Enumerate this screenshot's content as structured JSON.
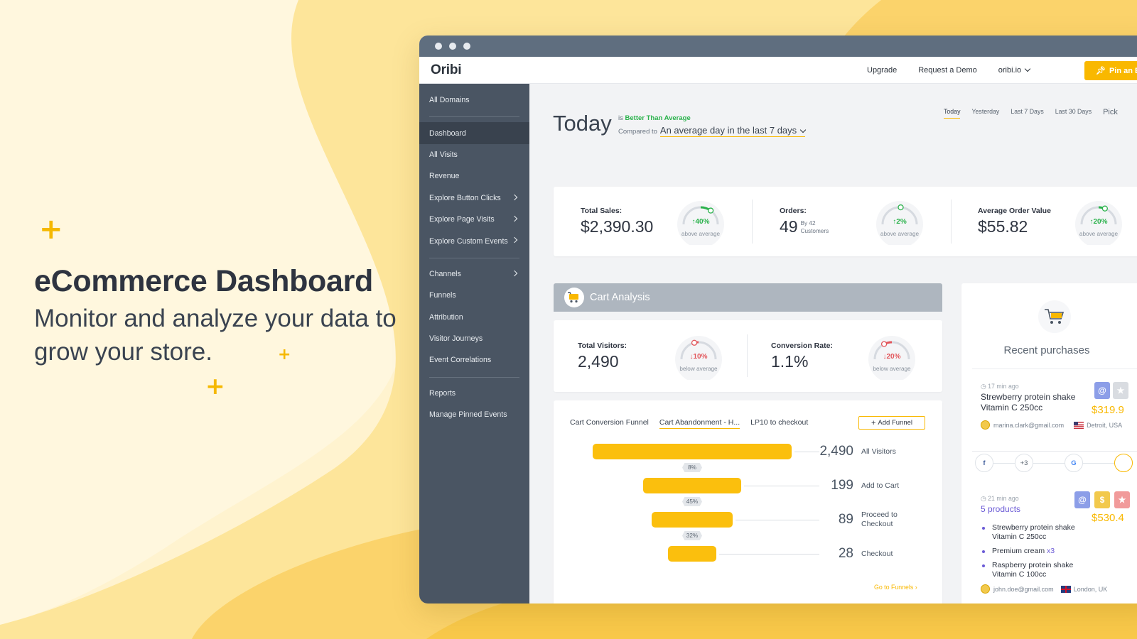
{
  "hero": {
    "title": "eCommerce Dashboard",
    "subtitle": "Monitor and analyze your data to grow your store."
  },
  "colors": {
    "accent": "#f9b800",
    "sidebar": "#4a5563",
    "positive": "#2bb24c",
    "negative": "#e2555a",
    "background": "#fff5d6"
  },
  "app": {
    "logo": "Oribi",
    "nav": {
      "upgrade": "Upgrade",
      "demo": "Request a Demo",
      "domain": "oribi.io",
      "pin": "Pin an E"
    }
  },
  "sidebar": {
    "groups": [
      [
        "All Domains"
      ],
      [
        "Dashboard",
        "All Visits",
        "Revenue",
        "Explore Button Clicks",
        "Explore Page Visits",
        "Explore Custom Events"
      ],
      [
        "Channels",
        "Funnels",
        "Attribution",
        "Visitor Journeys",
        "Event Correlations"
      ],
      [
        "Reports",
        "Manage Pinned Events"
      ]
    ],
    "active": "Dashboard",
    "items_with_arrow": [
      "Explore Button Clicks",
      "Explore Page Visits",
      "Explore Custom Events",
      "Channels"
    ]
  },
  "header": {
    "title": "Today",
    "is_text": "is",
    "status": "Better Than Average",
    "compared_to": "Compared to",
    "comparison": "An average day in the last 7 days",
    "ranges": [
      "Today",
      "Yesterday",
      "Last 7 Days",
      "Last 30 Days",
      "Pick"
    ],
    "selected_range": "Today"
  },
  "kpis": [
    {
      "label": "Total Sales:",
      "value": "$2,390.30",
      "change": "40%",
      "direction": "up",
      "caption": "above average",
      "gauge_fraction": 0.7
    },
    {
      "label": "Orders:",
      "value": "49",
      "sub": "By 42",
      "sub2": "Customers",
      "change": "2%",
      "direction": "up",
      "caption": "above average",
      "gauge_fraction": 0.52
    },
    {
      "label": "Average Order Value",
      "value": "$55.82",
      "change": "20%",
      "direction": "up",
      "caption": "above average",
      "gauge_fraction": 0.62
    }
  ],
  "cart": {
    "title": "Cart Analysis",
    "metrics": [
      {
        "label": "Total Visitors:",
        "value": "2,490",
        "change": "10%",
        "direction": "down",
        "caption": "below average",
        "gauge_fraction": 0.42
      },
      {
        "label": "Conversion Rate:",
        "value": "1.1%",
        "change": "20%",
        "direction": "down",
        "caption": "below average",
        "gauge_fraction": 0.35
      }
    ],
    "tabs": [
      "Cart Conversion Funnel",
      "Cart Abandonment - H...",
      "LP10 to checkout"
    ],
    "selected_tab": "Cart Abandonment - H...",
    "add_funnel": "Add Funnel",
    "go_to_funnels": "Go to Funnels",
    "funnel": [
      {
        "value": "2,490",
        "label": "All Visitors",
        "fraction": 1.0
      },
      {
        "value": "199",
        "label": "Add to Cart",
        "fraction": 0.49
      },
      {
        "value": "89",
        "label": "Proceed to Checkout",
        "fraction": 0.41
      },
      {
        "value": "28",
        "label": "Checkout",
        "fraction": 0.24
      }
    ],
    "step_rates": [
      "8%",
      "45%",
      "32%"
    ]
  },
  "recent": {
    "title": "Recent purchases",
    "items": [
      {
        "time": "17 min ago",
        "name": "Strewberry protein shake Vitamin C 250cc",
        "price": "$319.9",
        "email": "marina.clark@gmail.com",
        "location": "Detroit, USA",
        "journey_more": "+3"
      },
      {
        "time": "21 min ago",
        "name": "5 products",
        "price": "$530.4",
        "products": [
          {
            "name": "Strewberry protein shake Vitamin C 250cc",
            "qty": ""
          },
          {
            "name": "Premium cream",
            "qty": "x3"
          },
          {
            "name": "Raspberry protein shake Vitamin C 100cc",
            "qty": ""
          }
        ],
        "email": "john.doe@gmail.com",
        "location": "London, UK"
      }
    ]
  }
}
